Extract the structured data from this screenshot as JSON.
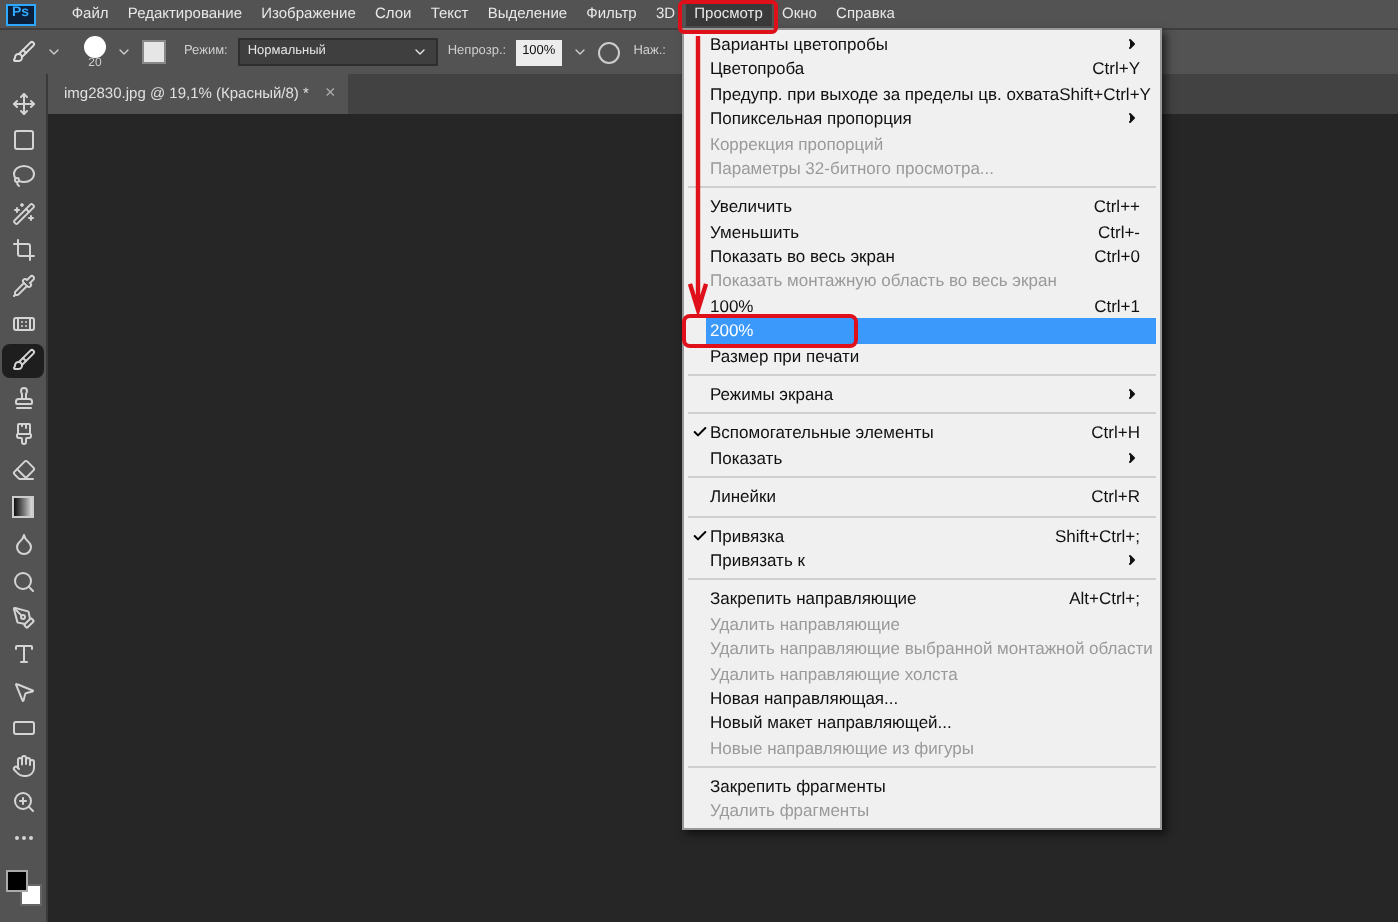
{
  "app_logo": "Ps",
  "menu_bar": [
    {
      "label": "Файл",
      "selected": false
    },
    {
      "label": "Редактирование",
      "selected": false
    },
    {
      "label": "Изображение",
      "selected": false
    },
    {
      "label": "Слои",
      "selected": false
    },
    {
      "label": "Текст",
      "selected": false
    },
    {
      "label": "Выделение",
      "selected": false
    },
    {
      "label": "Фильтр",
      "selected": false
    },
    {
      "label": "3D",
      "selected": false
    },
    {
      "label": "Просмотр",
      "selected": true
    },
    {
      "label": "Окно",
      "selected": false
    },
    {
      "label": "Справка",
      "selected": false
    }
  ],
  "options_bar": {
    "brush_size": "20",
    "mode_label": "Режим:",
    "mode_value": "Нормальный",
    "opacity_label": "Непрозр.:",
    "opacity_value": "100%",
    "pressure_label": "Наж.:"
  },
  "document_tab": {
    "title": "img2830.jpg @ 19,1% (Красный/8) *",
    "close": "×"
  },
  "tools": [
    {
      "kind": "move",
      "selected": false
    },
    {
      "kind": "marquee",
      "selected": false
    },
    {
      "kind": "lasso",
      "selected": false
    },
    {
      "kind": "quick-select",
      "selected": false
    },
    {
      "kind": "crop",
      "selected": false
    },
    {
      "kind": "eyedropper",
      "selected": false
    },
    {
      "kind": "healing",
      "selected": false
    },
    {
      "kind": "brush",
      "selected": true
    },
    {
      "kind": "stamp",
      "selected": false
    },
    {
      "kind": "history-brush",
      "selected": false
    },
    {
      "kind": "eraser",
      "selected": false
    },
    {
      "kind": "gradient",
      "selected": false
    },
    {
      "kind": "blur",
      "selected": false
    },
    {
      "kind": "dodge",
      "selected": false
    },
    {
      "kind": "pen",
      "selected": false
    },
    {
      "kind": "type",
      "selected": false
    },
    {
      "kind": "path-select",
      "selected": false
    },
    {
      "kind": "shape",
      "selected": false
    },
    {
      "kind": "hand",
      "selected": false
    },
    {
      "kind": "zoom",
      "selected": false
    },
    {
      "kind": "more",
      "selected": false
    }
  ],
  "view_menu": [
    {
      "kind": "item",
      "label": "Варианты цветопробы",
      "submenu": true,
      "disabled": false,
      "checked": false,
      "selected": false
    },
    {
      "kind": "item",
      "label": "Цветопроба",
      "shortcut": "Ctrl+Y",
      "submenu": false,
      "disabled": false,
      "checked": false,
      "selected": false
    },
    {
      "kind": "item",
      "label": "Предупр. при выходе за пределы цв. охвата",
      "shortcut": "Shift+Ctrl+Y",
      "submenu": false,
      "disabled": false,
      "checked": false,
      "selected": false
    },
    {
      "kind": "item",
      "label": "Попиксельная пропорция",
      "submenu": true,
      "disabled": false,
      "checked": false,
      "selected": false
    },
    {
      "kind": "item",
      "label": "Коррекция пропорций",
      "submenu": false,
      "disabled": true,
      "checked": false,
      "selected": false
    },
    {
      "kind": "item",
      "label": "Параметры 32-битного просмотра...",
      "submenu": false,
      "disabled": true,
      "checked": false,
      "selected": false
    },
    {
      "kind": "separator"
    },
    {
      "kind": "item",
      "label": "Увеличить",
      "shortcut": "Ctrl++",
      "submenu": false,
      "disabled": false,
      "checked": false,
      "selected": false
    },
    {
      "kind": "item",
      "label": "Уменьшить",
      "shortcut": "Ctrl+-",
      "submenu": false,
      "disabled": false,
      "checked": false,
      "selected": false
    },
    {
      "kind": "item",
      "label": "Показать во весь экран",
      "shortcut": "Ctrl+0",
      "submenu": false,
      "disabled": false,
      "checked": false,
      "selected": false
    },
    {
      "kind": "item",
      "label": "Показать монтажную область во весь экран",
      "submenu": false,
      "disabled": true,
      "checked": false,
      "selected": false
    },
    {
      "kind": "item",
      "label": "100%",
      "shortcut": "Ctrl+1",
      "submenu": false,
      "disabled": false,
      "checked": false,
      "selected": false
    },
    {
      "kind": "item",
      "label": "200%",
      "submenu": false,
      "disabled": false,
      "checked": false,
      "selected": true
    },
    {
      "kind": "item",
      "label": "Размер при печати",
      "submenu": false,
      "disabled": false,
      "checked": false,
      "selected": false
    },
    {
      "kind": "separator"
    },
    {
      "kind": "item",
      "label": "Режимы экрана",
      "submenu": true,
      "disabled": false,
      "checked": false,
      "selected": false
    },
    {
      "kind": "separator"
    },
    {
      "kind": "item",
      "label": "Вспомогательные элементы",
      "shortcut": "Ctrl+H",
      "submenu": false,
      "disabled": false,
      "checked": true,
      "selected": false
    },
    {
      "kind": "item",
      "label": "Показать",
      "submenu": true,
      "disabled": false,
      "checked": false,
      "selected": false
    },
    {
      "kind": "separator"
    },
    {
      "kind": "item",
      "label": "Линейки",
      "shortcut": "Ctrl+R",
      "submenu": false,
      "disabled": false,
      "checked": false,
      "selected": false
    },
    {
      "kind": "separator"
    },
    {
      "kind": "item",
      "label": "Привязка",
      "shortcut": "Shift+Ctrl+;",
      "submenu": false,
      "disabled": false,
      "checked": true,
      "selected": false
    },
    {
      "kind": "item",
      "label": "Привязать к",
      "submenu": true,
      "disabled": false,
      "checked": false,
      "selected": false
    },
    {
      "kind": "separator"
    },
    {
      "kind": "item",
      "label": "Закрепить направляющие",
      "shortcut": "Alt+Ctrl+;",
      "submenu": false,
      "disabled": false,
      "checked": false,
      "selected": false
    },
    {
      "kind": "item",
      "label": "Удалить направляющие",
      "submenu": false,
      "disabled": true,
      "checked": false,
      "selected": false
    },
    {
      "kind": "item",
      "label": "Удалить направляющие выбранной монтажной области",
      "submenu": false,
      "disabled": true,
      "checked": false,
      "selected": false
    },
    {
      "kind": "item",
      "label": "Удалить направляющие холста",
      "submenu": false,
      "disabled": true,
      "checked": false,
      "selected": false
    },
    {
      "kind": "item",
      "label": "Новая направляющая...",
      "submenu": false,
      "disabled": false,
      "checked": false,
      "selected": false
    },
    {
      "kind": "item",
      "label": "Новый макет направляющей...",
      "submenu": false,
      "disabled": false,
      "checked": false,
      "selected": false
    },
    {
      "kind": "item",
      "label": "Новые направляющие из фигуры",
      "submenu": false,
      "disabled": true,
      "checked": false,
      "selected": false
    },
    {
      "kind": "separator"
    },
    {
      "kind": "item",
      "label": "Закрепить фрагменты",
      "submenu": false,
      "disabled": false,
      "checked": false,
      "selected": false
    },
    {
      "kind": "item",
      "label": "Удалить фрагменты",
      "submenu": false,
      "disabled": true,
      "checked": false,
      "selected": false
    }
  ]
}
